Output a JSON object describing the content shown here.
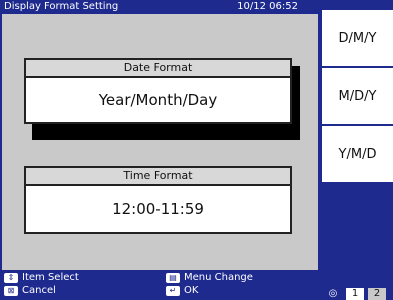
{
  "header": {
    "title": "Display Format Setting",
    "datetime": "10/12 06:52"
  },
  "date_format": {
    "label": "Date Format",
    "value": "Year/Month/Day"
  },
  "time_format": {
    "label": "Time Format",
    "value": "12:00-11:59"
  },
  "help": {
    "item_select": "Item Select",
    "menu_change": "Menu Change",
    "cancel": "Cancel",
    "ok": "OK"
  },
  "softkeys": [
    "D/M/Y",
    "M/D/Y",
    "Y/M/D"
  ],
  "page_indicator": {
    "current": "1",
    "next": "2"
  },
  "colors": {
    "background": "#1e2a8e",
    "panel": "#c9c9c9",
    "card_head": "#d8d8d8"
  }
}
